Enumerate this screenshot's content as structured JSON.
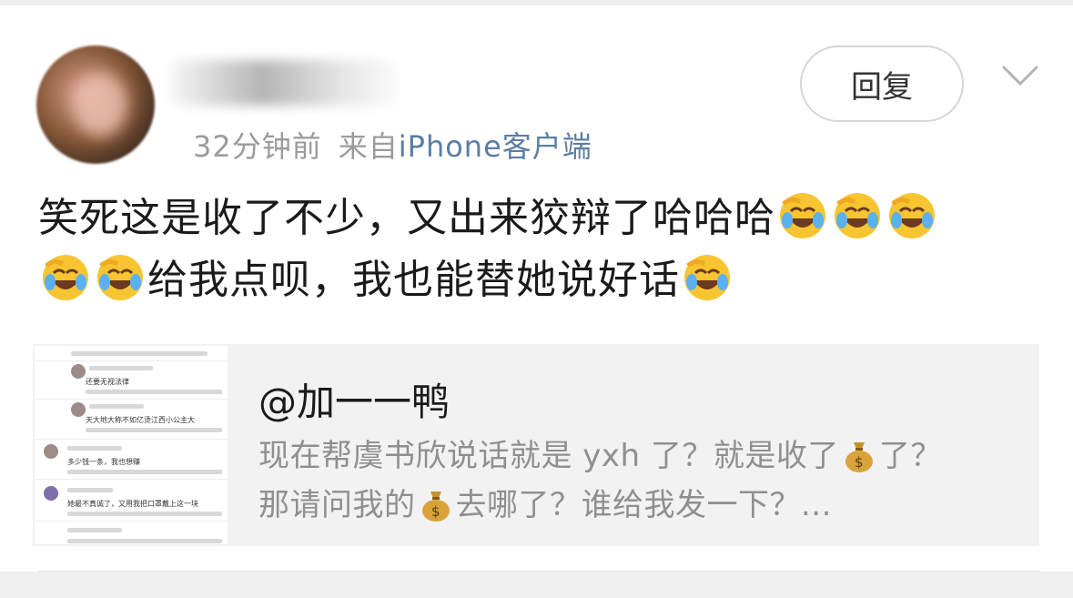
{
  "post": {
    "time": "32分钟前",
    "source_prefix": "来自",
    "client": "iPhone客户端",
    "reply_label": "回复",
    "content_line1": "笑死这是收了不少，又出来狡辩了哈哈哈",
    "content_line2_a": "给我点呗，我也能替她说好话"
  },
  "quote": {
    "author": "@加一一鸭",
    "body_a": "现在帮虞书欣说话就是 yxh 了？就是收了",
    "body_b": "了？",
    "body_c": "那请问我的",
    "body_d": "去哪了？谁给我发一下？..."
  },
  "thumbnail": {
    "c1": "还要无视法律",
    "c2": "天大地大称不如亿烫江西小公主大",
    "c3": "多少钱一条，我也想赚",
    "c4": "她最不真诚了，又用我把口罩戴上这一块"
  },
  "icons": {
    "emoji": "rolling-on-floor-laughing-icon",
    "money": "money-bag-icon",
    "chevron": "chevron-down-icon"
  },
  "colors": {
    "client_link": "#5b7da3",
    "meta_gray": "#9b9b9b",
    "quote_bg": "#f2f2f2"
  }
}
